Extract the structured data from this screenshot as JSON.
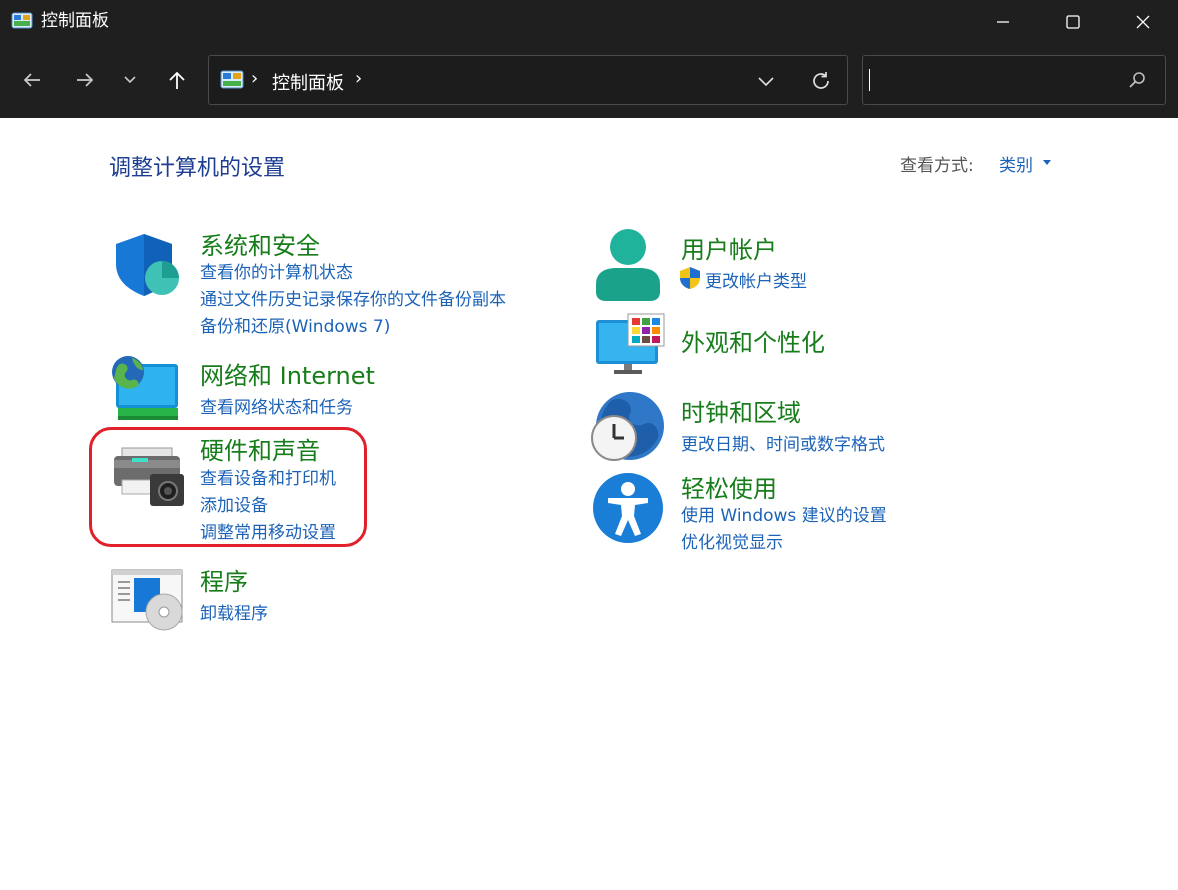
{
  "window": {
    "title": "控制面板"
  },
  "address": {
    "crumb": "控制面板",
    "separator": "›"
  },
  "search": {
    "value": "",
    "placeholder": ""
  },
  "header": {
    "title": "调整计算机的设置",
    "view_by_label": "查看方式:",
    "view_by_value": "类别"
  },
  "categories": {
    "security": {
      "title": "系统和安全",
      "links": [
        "查看你的计算机状态",
        "通过文件历史记录保存你的文件备份副本",
        "备份和还原(Windows 7)"
      ],
      "icon": "shield-icon"
    },
    "network": {
      "title": "网络和 Internet",
      "links": [
        "查看网络状态和任务"
      ],
      "icon": "network-globe-icon"
    },
    "hardware": {
      "title": "硬件和声音",
      "links": [
        "查看设备和打印机",
        "添加设备",
        "调整常用移动设置"
      ],
      "icon": "printer-icon"
    },
    "programs": {
      "title": "程序",
      "links": [
        "卸载程序"
      ],
      "icon": "programs-disc-icon"
    },
    "accounts": {
      "title": "用户帐户",
      "links": [
        "更改帐户类型"
      ],
      "icon": "user-icon"
    },
    "appearance": {
      "title": "外观和个性化",
      "links": [],
      "icon": "monitor-palette-icon"
    },
    "clock": {
      "title": "时钟和区域",
      "links": [
        "更改日期、时间或数字格式"
      ],
      "icon": "clock-globe-icon"
    },
    "ease": {
      "title": "轻松使用",
      "links": [
        "使用 Windows 建议的设置",
        "优化视觉显示"
      ],
      "icon": "accessibility-icon"
    }
  },
  "colors": {
    "category_title": "#177d1a",
    "link": "#1c63b8",
    "page_title": "#1c3d91",
    "highlight": "#e0202a",
    "chrome": "#1f1f1f"
  }
}
